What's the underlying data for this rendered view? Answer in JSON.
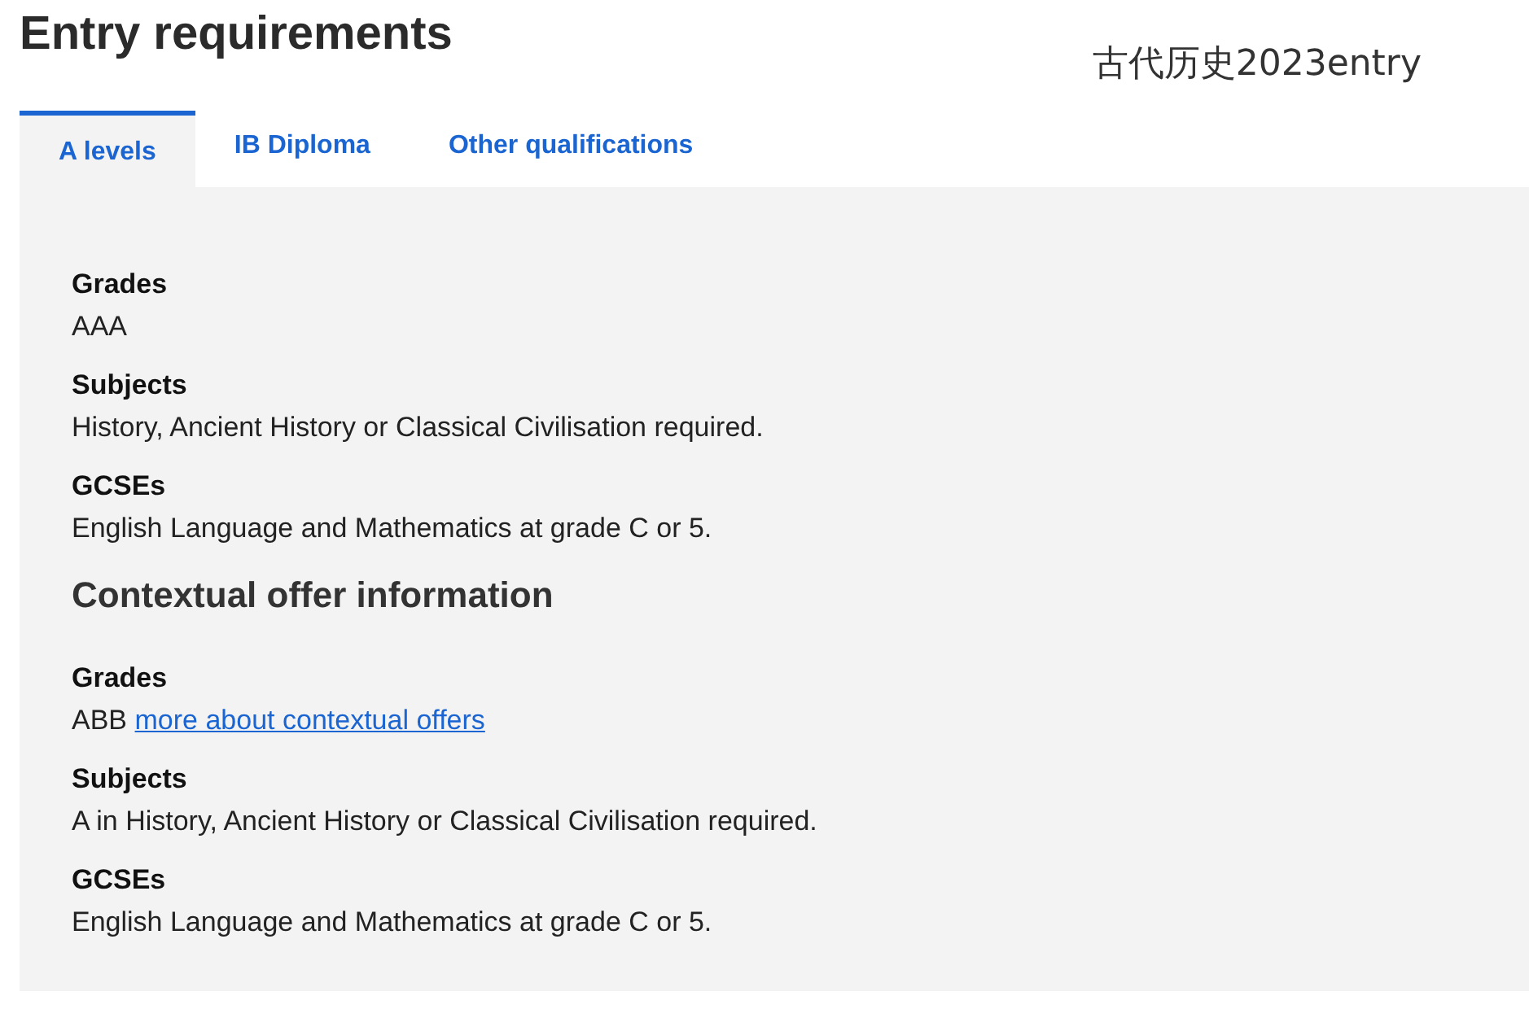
{
  "title": "Entry requirements",
  "annotation": "古代历史2023entry",
  "tabs": [
    {
      "label": "A levels",
      "selected": true
    },
    {
      "label": "IB Diploma",
      "selected": false
    },
    {
      "label": "Other qualifications",
      "selected": false
    }
  ],
  "requirements": [
    {
      "heading": "Grades",
      "text": "AAA"
    },
    {
      "heading": "Subjects",
      "text": "History, Ancient History or Classical Civilisation required."
    },
    {
      "heading": "GCSEs",
      "text": "English Language and Mathematics at grade C or 5."
    }
  ],
  "contextual": {
    "heading": "Contextual offer information",
    "items": [
      {
        "heading": "Grades",
        "text": "ABB",
        "link": "more about contextual offers"
      },
      {
        "heading": "Subjects",
        "text": "A in History, Ancient History or Classical Civilisation required."
      },
      {
        "heading": "GCSEs",
        "text": "English Language and Mathematics at grade C or 5."
      }
    ]
  }
}
